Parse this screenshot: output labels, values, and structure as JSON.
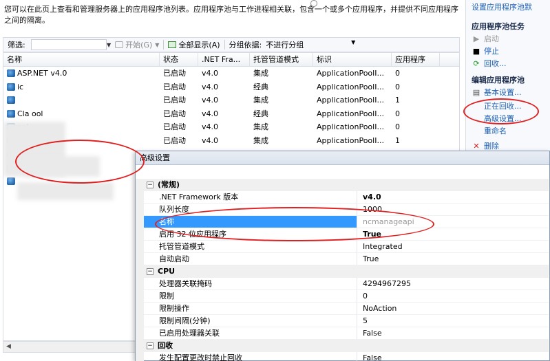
{
  "description": "您可以在此页上查看和管理服务器上的应用程序池列表。应用程序池与工作进程相关联，包含一个或多个应用程序，并提供不同应用程序之间的隔离。",
  "filter": {
    "label": "筛选:",
    "start_label": "开始(G)",
    "show_all_label": "全部显示(A)",
    "group_label": "分组依据:",
    "group_value": "不进行分组"
  },
  "table": {
    "columns": [
      "名称",
      "状态",
      ".NET Fra...",
      "托管管道模式",
      "标识",
      "应用程序"
    ],
    "rows": [
      {
        "name": "ASP.NET v4.0",
        "status": "已启动",
        "net": "v4.0",
        "mode": "集成",
        "identity": "ApplicationPoolI...",
        "apps": "0"
      },
      {
        "name": "ic",
        "status": "已启动",
        "net": "v4.0",
        "mode": "经典",
        "identity": "ApplicationPoolI...",
        "apps": "0"
      },
      {
        "name": "",
        "status": "已启动",
        "net": "v4.0",
        "mode": "集成",
        "identity": "ApplicationPoolI...",
        "apps": "1"
      },
      {
        "name": "Cla          ool",
        "status": "已启动",
        "net": "v4.0",
        "mode": "经典",
        "identity": "ApplicationPoolI...",
        "apps": "0"
      },
      {
        "name": "ool",
        "status": "已启动",
        "net": "v4.0",
        "mode": "集成",
        "identity": "ApplicationPoolI...",
        "apps": "0"
      },
      {
        "name": "",
        "status": "已启动",
        "net": "v4.0",
        "mode": "集成",
        "identity": "ApplicationPoolI...",
        "apps": "1"
      }
    ]
  },
  "actions": {
    "top_link": "设置应用程序池默",
    "section1": "应用程序池任务",
    "start": "启动",
    "stop": "停止",
    "recycle": "回收...",
    "section2": "编辑应用程序池",
    "basic": "基本设置...",
    "recycling": "正在回收...",
    "advanced": "高级设置...",
    "rename": "重命名",
    "delete": "删除"
  },
  "dialog": {
    "title": "高级设置",
    "categories": [
      {
        "name": "(常规)",
        "toggle": "⊟",
        "props": [
          {
            "key": ".NET Framework 版本",
            "value": "v4.0",
            "bold": true
          },
          {
            "key": "队列长度",
            "value": "1000"
          },
          {
            "key": "名称",
            "value": "ncmanageapi",
            "selected": true
          },
          {
            "key": "启用 32 位应用程序",
            "value": "True",
            "bold": true
          },
          {
            "key": "托管管道模式",
            "value": "Integrated"
          },
          {
            "key": "自动启动",
            "value": "True"
          }
        ]
      },
      {
        "name": "CPU",
        "toggle": "⊟",
        "props": [
          {
            "key": "处理器关联掩码",
            "value": "4294967295"
          },
          {
            "key": "限制",
            "value": "0"
          },
          {
            "key": "限制操作",
            "value": "NoAction"
          },
          {
            "key": "限制间隔(分钟)",
            "value": "5"
          },
          {
            "key": "已启用处理器关联",
            "value": "False"
          }
        ]
      },
      {
        "name": "回收",
        "toggle": "⊟",
        "props": [
          {
            "key": "发生配置更改时禁止回收",
            "value": "False"
          }
        ]
      }
    ]
  },
  "colors": {
    "annotation": "#e02020",
    "link": "#1b5fb5",
    "selection": "#3399ff"
  }
}
